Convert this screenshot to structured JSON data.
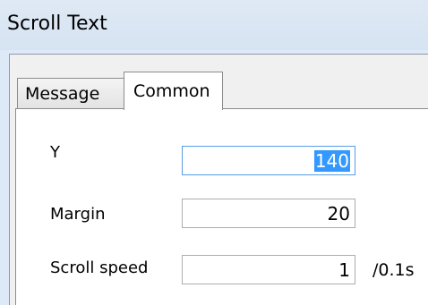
{
  "window": {
    "title": "Scroll Text"
  },
  "tabs": [
    {
      "label": "Message",
      "active": false
    },
    {
      "label": "Common",
      "active": true
    }
  ],
  "fields": {
    "y": {
      "label": "Y",
      "value": "140",
      "focused": true
    },
    "margin": {
      "label": "Margin",
      "value": "20"
    },
    "scroll_speed": {
      "label": "Scroll speed",
      "value": "1",
      "unit": "/0.1s"
    }
  },
  "colors": {
    "title_bg": "#dfe9f5",
    "focus_border": "#569de5",
    "selection": "#3399ff"
  }
}
